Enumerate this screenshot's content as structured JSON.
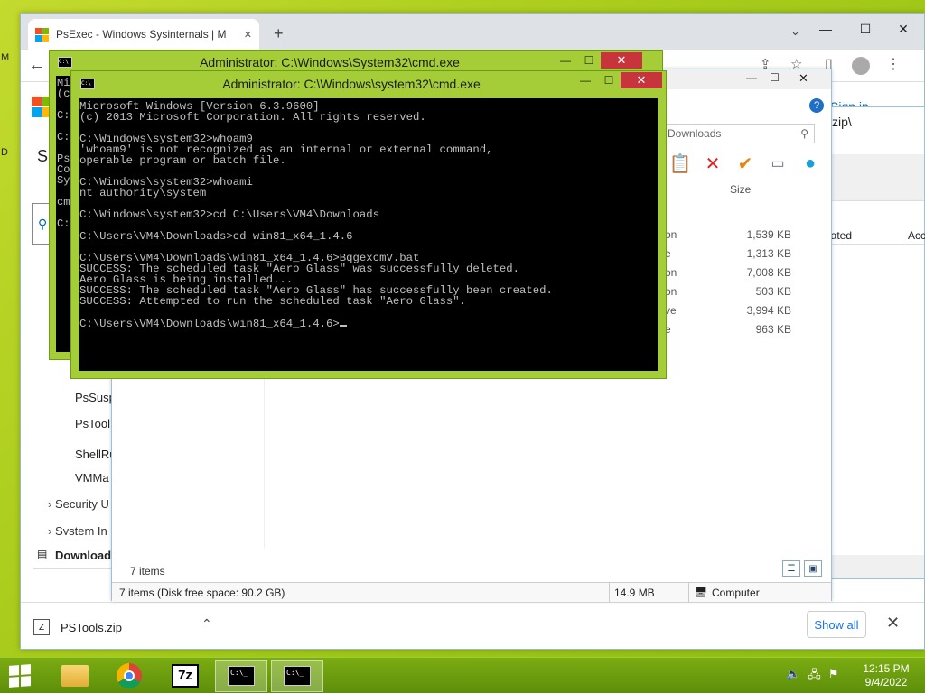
{
  "chrome": {
    "tab_title": "PsExec - Windows Sysinternals | M",
    "newtab": "+",
    "tab_menu": "⌄",
    "minimize": "—",
    "maximize": "☐",
    "close": "✕",
    "back": "←"
  },
  "page": {
    "signin": "Sign in",
    "s_letter": "S",
    "nav_items": [
      "PsSusp",
      "PsTool",
      "ShellRu",
      "VMMa"
    ],
    "tree_items": [
      "Security U",
      "System In"
    ],
    "downloads_side": "Download"
  },
  "download_bar": {
    "file": "PSTools.zip",
    "show_all": "Show all",
    "close": "✕"
  },
  "explorer": {
    "search_placeholder": "h Downloads",
    "col_size": "Size",
    "files": [
      {
        "type": "on",
        "size": "1,539 KB"
      },
      {
        "type": "e",
        "size": "1,313 KB"
      },
      {
        "type": "on",
        "size": "7,008 KB"
      },
      {
        "type": "on",
        "size": "503 KB"
      },
      {
        "type": "ve",
        "size": "3,994 KB"
      },
      {
        "type": "e",
        "size": "963 KB"
      }
    ],
    "item_count": "7 items",
    "status_items": "7 items (Disk free space: 90.2 GB)",
    "status_size": "14.9 MB",
    "status_location": "Computer"
  },
  "explorer2": {
    "title_fragment": "zip\\",
    "col_created": "eated",
    "col_access": "Acc"
  },
  "cmd_back": {
    "title": "Administrator: C:\\Windows\\System32\\cmd.exe",
    "lines": "Mi\n(c\n\nC:\n\nC:\n\nPs\nCo\nSy\n\ncm\n\nC:"
  },
  "cmd_front": {
    "title": "Administrator: C:\\Windows\\system32\\cmd.exe",
    "minimize": "—",
    "maximize": "☐",
    "close": "✕",
    "console": "Microsoft Windows [Version 6.3.9600]\n(c) 2013 Microsoft Corporation. All rights reserved.\n\nC:\\Windows\\system32>whoam9\n'whoam9' is not recognized as an internal or external command,\noperable program or batch file.\n\nC:\\Windows\\system32>whoami\nnt authority\\system\n\nC:\\Windows\\system32>cd C:\\Users\\VM4\\Downloads\n\nC:\\Users\\VM4\\Downloads>cd win81_x64_1.4.6\n\nC:\\Users\\VM4\\Downloads\\win81_x64_1.4.6>BqgexcmV.bat\nSUCCESS: The scheduled task \"Aero Glass\" was successfully deleted.\nAero Glass is being installed...\nSUCCESS: The scheduled task \"Aero Glass\" has successfully been created.\nSUCCESS: Attempted to run the scheduled task \"Aero Glass\".\n\nC:\\Users\\VM4\\Downloads\\win81_x64_1.4.6>"
  },
  "taskbar": {
    "sevenzip": "7z",
    "time": "12:15 PM",
    "date": "9/4/2022"
  },
  "colors": {
    "desktop": "#a9cc1c",
    "window_frame": "#a5cd38",
    "close_red": "#c7343b",
    "link_blue": "#1a73e8"
  }
}
